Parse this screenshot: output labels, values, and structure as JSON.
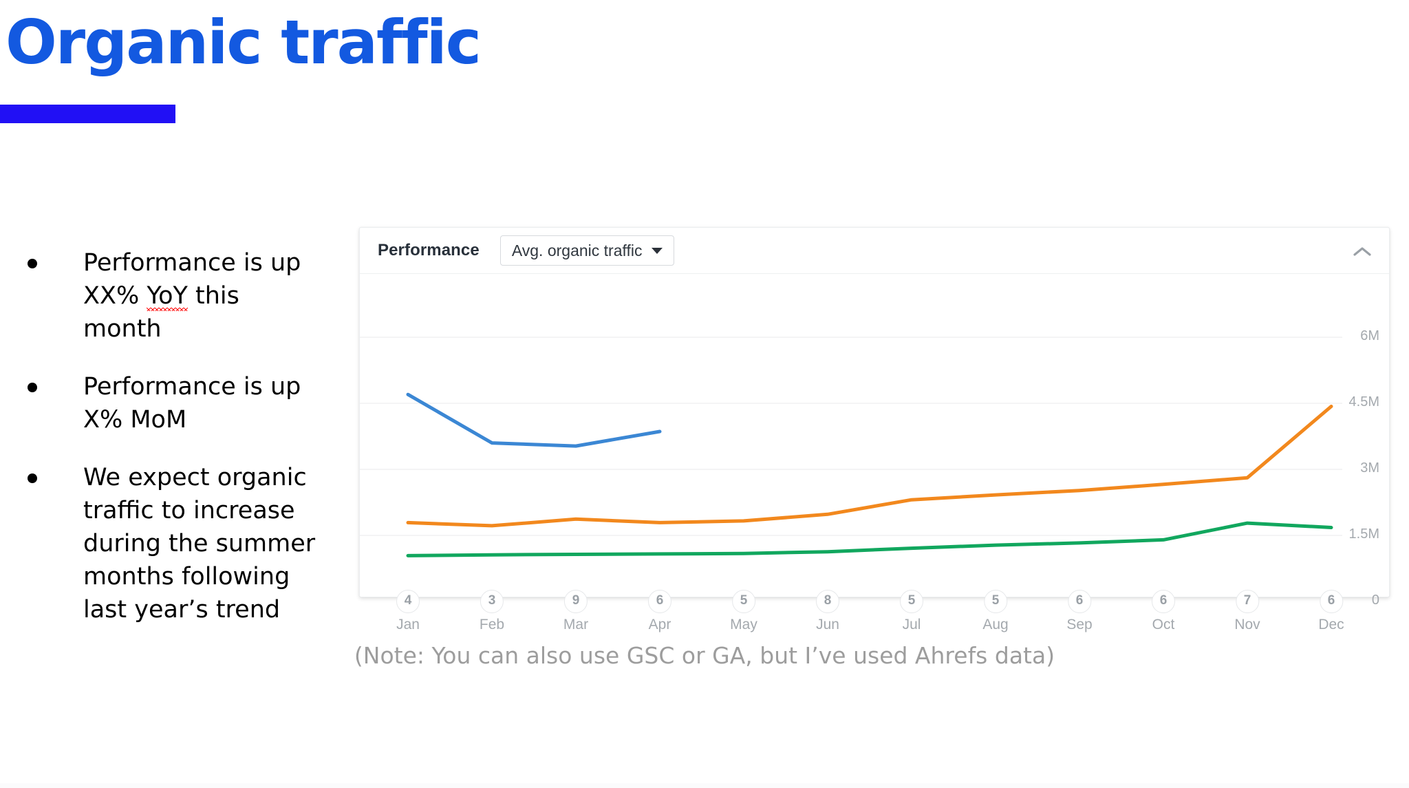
{
  "slide": {
    "title": "Organic traffic",
    "title_color": "#1359E0",
    "rule_color": "#2110F5",
    "note": "(Note: You can also use GSC or GA, but I’ve used Ahrefs data)"
  },
  "bullets": [
    {
      "line1": "Performance is up",
      "pre": "XX% ",
      "misspelled": "YoY",
      "post": " this month"
    },
    {
      "line1": "Performance is up",
      "pre": "X% MoM",
      "misspelled": "",
      "post": ""
    },
    {
      "line1": "We expect organic",
      "pre": "traffic to increase during the summer months following last year’s trend",
      "misspelled": "",
      "post": ""
    }
  ],
  "chart_card": {
    "title": "Performance",
    "metric_select": {
      "value": "Avg. organic traffic",
      "caret_icon": "caret-down-icon"
    },
    "collapse_icon": "chevron-up-icon"
  },
  "chart_data": {
    "type": "line",
    "title": "Performance",
    "xlabel": "",
    "ylabel": "",
    "grid": true,
    "legend": "none",
    "ylim": [
      0,
      6000000
    ],
    "yticks": [
      0,
      1500000,
      3000000,
      4500000,
      6000000
    ],
    "ytick_labels": [
      "0",
      "1.5M",
      "3M",
      "4.5M",
      "6M"
    ],
    "categories": [
      "Jan",
      "Feb",
      "Mar",
      "Apr",
      "May",
      "Jun",
      "Jul",
      "Aug",
      "Sep",
      "Oct",
      "Nov",
      "Dec"
    ],
    "x_badges": [
      "4",
      "3",
      "9",
      "6",
      "5",
      "8",
      "5",
      "5",
      "6",
      "6",
      "7",
      "6"
    ],
    "series": [
      {
        "name": "series-blue",
        "color": "#3B87D4",
        "values": [
          4700000,
          3600000,
          3530000,
          3860000,
          null,
          null,
          null,
          null,
          null,
          null,
          null,
          null
        ]
      },
      {
        "name": "series-orange",
        "color": "#F2881D",
        "values": [
          1790000,
          1720000,
          1870000,
          1790000,
          1830000,
          1980000,
          2310000,
          2420000,
          2520000,
          2660000,
          2810000,
          4430000
        ]
      },
      {
        "name": "series-green",
        "color": "#11A75E",
        "values": [
          1040000,
          1060000,
          1070000,
          1080000,
          1090000,
          1130000,
          1210000,
          1280000,
          1330000,
          1400000,
          1780000,
          1680000
        ]
      }
    ]
  }
}
